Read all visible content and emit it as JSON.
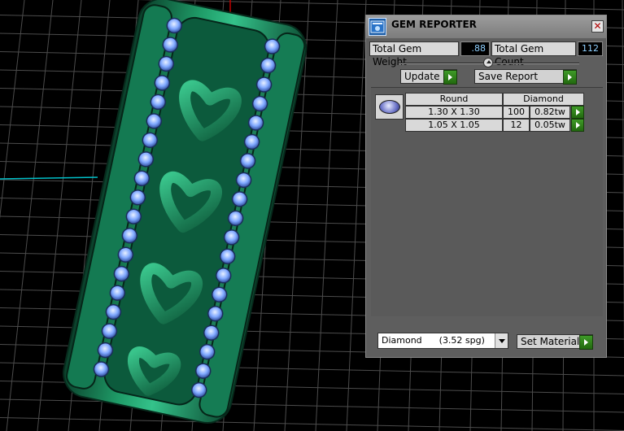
{
  "panel": {
    "title": "GEM REPORTER",
    "close_glyph": "✕",
    "icon": "gem-reporter-app-icon",
    "total_weight_label": "Total Gem Weight",
    "total_weight_value": ".88",
    "total_count_label": "Total Gem Count",
    "total_count_value": "112",
    "update_label": "Update",
    "save_report_label": "Save Report",
    "table": {
      "headers": [
        "Round",
        "Diamond"
      ],
      "rows": [
        {
          "size": "1.30 X 1.30",
          "count": "100",
          "weight": "0.82tw"
        },
        {
          "size": "1.05 X 1.05",
          "count": "12",
          "weight": "0.05tw"
        }
      ]
    },
    "material_selected": "Diamond      (3.52 spg)",
    "set_material_label": "Set Material"
  },
  "colors": {
    "ring_green": "#1f8f63",
    "gem_blue": "#7fa8ff",
    "axis_red": "#c00000",
    "axis_cyan": "#00bfc8",
    "panel_bg": "#5e5e5e",
    "go_green": "#2f8a1c"
  }
}
